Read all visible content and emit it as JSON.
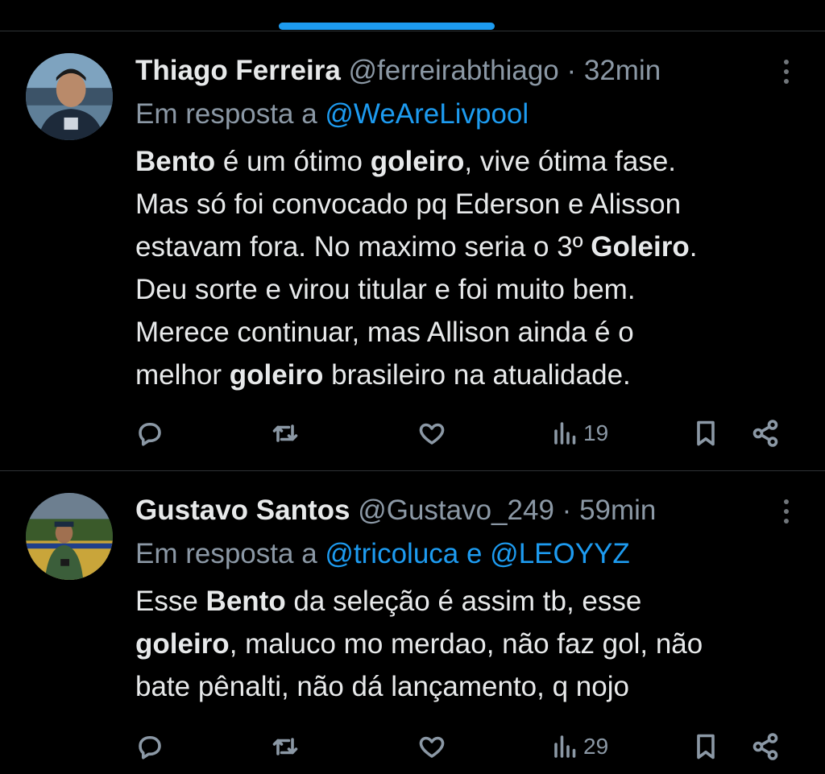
{
  "tweets": [
    {
      "name": "Thiago Ferreira",
      "handle": "@ferreirabthiago",
      "separator": "·",
      "time": "32min",
      "reply_prefix": "Em resposta a",
      "reply_mentions": "@WeAreLivpool",
      "body": [
        [
          {
            "t": "Bento",
            "b": true
          },
          {
            "t": " é um ótimo ",
            "b": false
          },
          {
            "t": "goleiro",
            "b": true
          },
          {
            "t": ", vive ótima fase.",
            "b": false
          }
        ],
        [
          {
            "t": "Mas só foi convocado pq Ederson e Alisson",
            "b": false
          }
        ],
        [
          {
            "t": "estavam fora. No maximo seria o 3º ",
            "b": false
          },
          {
            "t": "Goleiro",
            "b": true
          },
          {
            "t": ".",
            "b": false
          }
        ],
        [
          {
            "t": "Deu sorte e virou titular e foi muito bem.",
            "b": false
          }
        ],
        [
          {
            "t": "Merece continuar, mas Allison ainda é o",
            "b": false
          }
        ],
        [
          {
            "t": "melhor ",
            "b": false
          },
          {
            "t": "goleiro",
            "b": true
          },
          {
            "t": " brasileiro na atualidade.",
            "b": false
          }
        ]
      ],
      "views": "19",
      "avatar_colors": {
        "bg": "#4a6f8a",
        "shirt": "#1d2a3a",
        "skin": "#b98a6a"
      }
    },
    {
      "name": "Gustavo Santos",
      "handle": "@Gustavo_249",
      "separator": "·",
      "time": "59min",
      "reply_prefix": "Em resposta a",
      "reply_mentions": "@tricoluca e @LEOYYZ",
      "body": [
        [
          {
            "t": "Esse ",
            "b": false
          },
          {
            "t": "Bento",
            "b": true
          },
          {
            "t": " da seleção é assim tb, esse",
            "b": false
          }
        ],
        [
          {
            "t": "goleiro",
            "b": true
          },
          {
            "t": ", maluco mo merdao, não faz gol, não",
            "b": false
          }
        ],
        [
          {
            "t": "bate pênalti, não dá lançamento, q nojo",
            "b": false
          }
        ]
      ],
      "views": "29",
      "avatar_colors": {
        "bg": "#2d4a6a",
        "shirt": "#3b5e3a",
        "skin": "#a07050"
      }
    }
  ],
  "icons": {
    "reply": "reply-icon",
    "retweet": "retweet-icon",
    "like": "heart-icon",
    "views": "views-bar-icon",
    "bookmark": "bookmark-icon",
    "share": "share-icon",
    "more": "more-vertical-icon"
  },
  "colors": {
    "background": "#000000",
    "text": "#e7e9ea",
    "secondary": "#8b98a5",
    "accent": "#1d9bf0",
    "divider": "#2f3336"
  }
}
